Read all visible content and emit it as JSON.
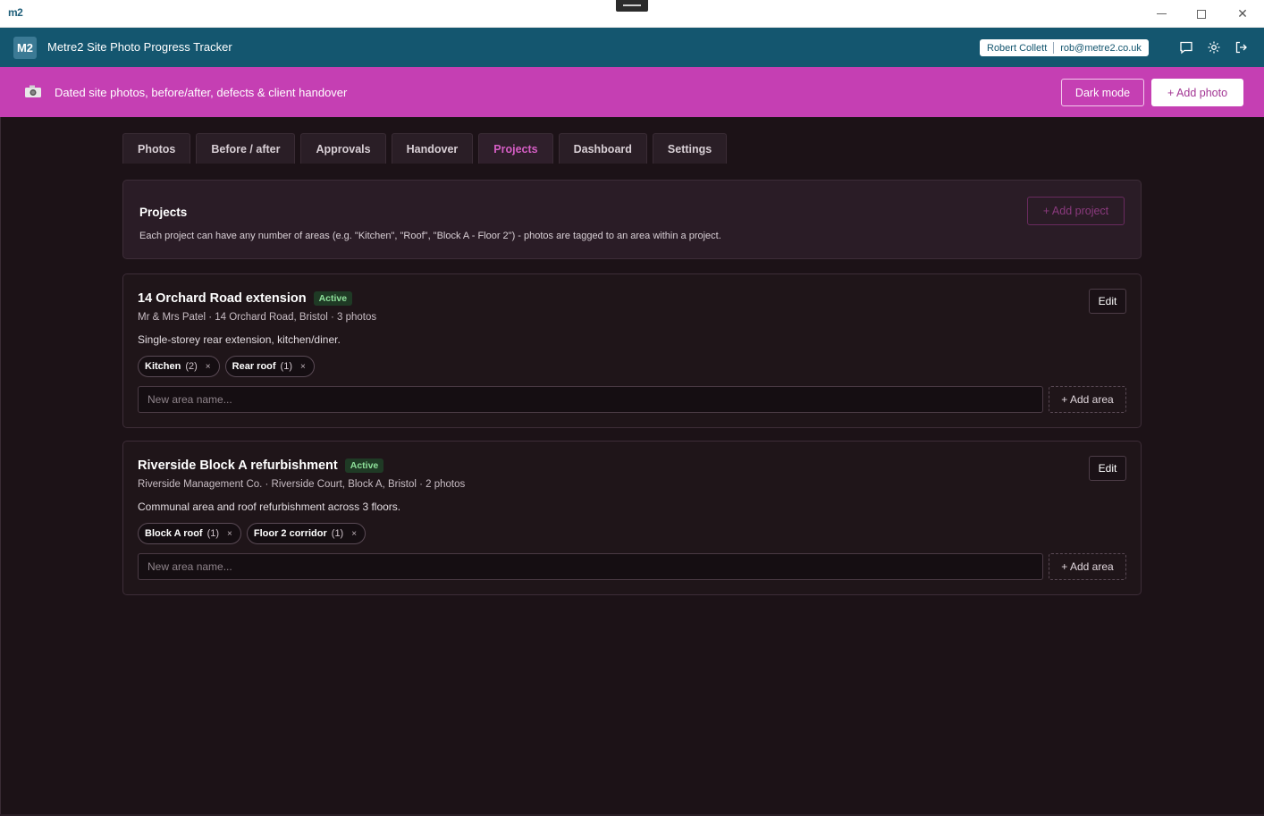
{
  "window": {
    "logo_text": "m2",
    "controls": {
      "minimize": "minimize",
      "maximize": "maximize",
      "close": "✕"
    }
  },
  "header": {
    "badge": "M2",
    "title": "Metre2 Site Photo Progress Tracker",
    "user_name": "Robert Collett",
    "user_email": "rob@metre2.co.uk"
  },
  "banner": {
    "text": "Dated site photos, before/after, defects & client handover",
    "dark_mode_label": "Dark mode",
    "add_photo_label": "+ Add photo"
  },
  "tabs": [
    {
      "label": "Photos"
    },
    {
      "label": "Before / after"
    },
    {
      "label": "Approvals"
    },
    {
      "label": "Handover"
    },
    {
      "label": "Projects",
      "active": true
    },
    {
      "label": "Dashboard"
    },
    {
      "label": "Settings"
    }
  ],
  "projects_intro": {
    "title": "Projects",
    "description": "Each project can have any number of areas (e.g. \"Kitchen\", \"Roof\", \"Block A - Floor 2\") - photos are tagged to an area within a project.",
    "add_label": "+ Add project"
  },
  "projects": [
    {
      "name": "14 Orchard Road extension",
      "status": "Active",
      "meta": "Mr & Mrs Patel · 14 Orchard Road, Bristol · 3 photos",
      "description": "Single-storey rear extension, kitchen/diner.",
      "edit_label": "Edit",
      "areas": [
        {
          "name": "Kitchen",
          "count": "(2)",
          "remove": "×"
        },
        {
          "name": "Rear roof",
          "count": "(1)",
          "remove": "×"
        }
      ],
      "new_area_placeholder": "New area name...",
      "add_area_label": "+ Add area"
    },
    {
      "name": "Riverside Block A refurbishment",
      "status": "Active",
      "meta": "Riverside Management Co. · Riverside Court, Block A, Bristol · 2 photos",
      "description": "Communal area and roof refurbishment across 3 floors.",
      "edit_label": "Edit",
      "areas": [
        {
          "name": "Block A roof",
          "count": "(1)",
          "remove": "×"
        },
        {
          "name": "Floor 2 corridor",
          "count": "(1)",
          "remove": "×"
        }
      ],
      "new_area_placeholder": "New area name...",
      "add_area_label": "+ Add area"
    }
  ],
  "colors": {
    "header": "#14566f",
    "banner": "#c53fb3",
    "background": "#1c1217",
    "accent": "#d55ec4",
    "status": "#8ee09a"
  }
}
